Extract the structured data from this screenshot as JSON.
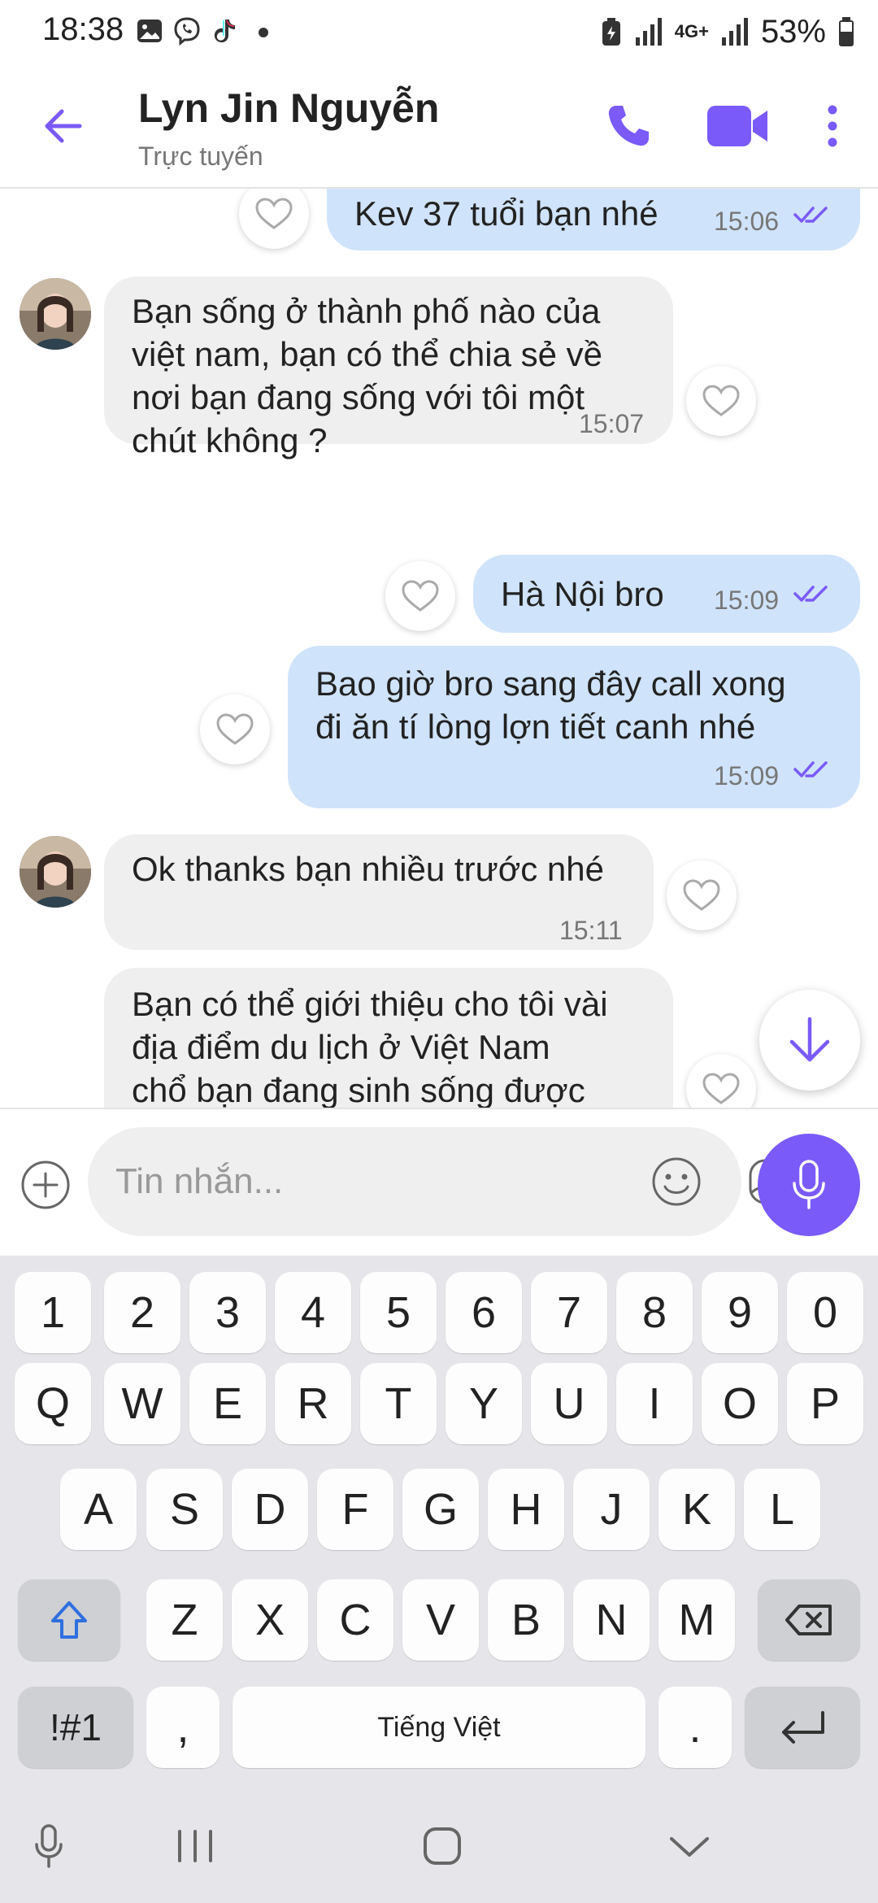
{
  "status_bar": {
    "time": "18:38",
    "network": "4G+",
    "battery": "53%"
  },
  "header": {
    "contact_name": "Lyn Jin Nguyễn",
    "contact_status": "Trực tuyến",
    "accent_color": "#7a5af8"
  },
  "messages": [
    {
      "direction": "out",
      "text": "Kev 37 tuổi bạn nhé",
      "time": "15:06",
      "read": true
    },
    {
      "direction": "in",
      "text": "Bạn sống ở thành phố nào của\nviệt nam, bạn có thể chia sẻ về\nnơi bạn đang sống với tôi một\nchút không ?",
      "time": "15:07"
    },
    {
      "direction": "out",
      "text": "Hà Nội bro",
      "time": "15:09",
      "read": true
    },
    {
      "direction": "out",
      "text": "Bao giờ bro sang đây call xong\nđi ăn tí lòng lợn tiết canh nhé",
      "time": "15:09",
      "read": true
    },
    {
      "direction": "in",
      "text": "Ok thanks bạn nhiều trước nhé",
      "time": "15:11"
    },
    {
      "direction": "in",
      "text": "Bạn có thể giới thiệu cho tôi vài\nđịa điểm du lịch ở Việt Nam\nchổ bạn đang sinh sống được"
    }
  ],
  "composer": {
    "placeholder": "Tin nhắn..."
  },
  "keyboard": {
    "row_numbers": [
      "1",
      "2",
      "3",
      "4",
      "5",
      "6",
      "7",
      "8",
      "9",
      "0"
    ],
    "row_q": [
      "Q",
      "W",
      "E",
      "R",
      "T",
      "Y",
      "U",
      "I",
      "O",
      "P"
    ],
    "row_a": [
      "A",
      "S",
      "D",
      "F",
      "G",
      "H",
      "J",
      "K",
      "L"
    ],
    "row_z": [
      "Z",
      "X",
      "C",
      "V",
      "B",
      "N",
      "M"
    ],
    "symbols_label": "!#1",
    "comma_label": ",",
    "space_label": "Tiếng Việt",
    "period_label": "."
  }
}
